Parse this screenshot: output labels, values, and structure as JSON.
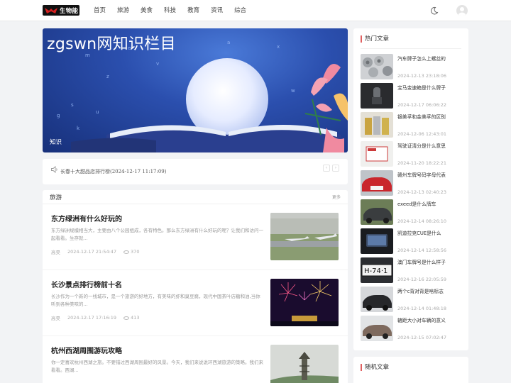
{
  "header": {
    "logo_text": "生物能",
    "nav": [
      "首页",
      "旅游",
      "美食",
      "科技",
      "教育",
      "资讯",
      "综合"
    ],
    "theme_icon": "moon-icon",
    "avatar_icon": "user-avatar-icon"
  },
  "banner": {
    "title": "zgswn网知识栏目",
    "tag": "知识"
  },
  "notice": {
    "text": "长春十大甜品店排行榜(2024-12-17 11:17:09)",
    "icon": "speaker-icon"
  },
  "list": {
    "title": "旅游",
    "more": "更多",
    "articles": [
      {
        "title": "东方绿洲有什么好玩的",
        "excerpt": "东方绿洲规模相当大，主要由八个公园组成，各有特色。那么东方绿洲有什么好玩的呢？让我们和访问一起看看。生存就...",
        "author": "高昊",
        "date": "2024-12-17 21:54:47",
        "views": "370"
      },
      {
        "title": "长沙景点排行榜前十名",
        "excerpt": "长沙作为一个新的一线城市，是一个旅游的好地方，有美味的虾和臭豆腐，现代中国茶叶店糖和油,当你听到各种美味的...",
        "author": "高昊",
        "date": "2024-12-17 17:16:19",
        "views": "413"
      },
      {
        "title": "杭州西湖周围游玩攻略",
        "excerpt": "你一定喜欢杭州西湖之旅。不要错过西湖周围最好的风景。今天，我们来说说环西湖旅游的策略。我们来看看。西湖..."
      }
    ]
  },
  "sidebar": {
    "hot_title": "热门文章",
    "hot": [
      {
        "title": "汽车牌子怎么上螺丝的",
        "date": "2024-12-13 23:18:06"
      },
      {
        "title": "宝马变速箱是什么牌子",
        "date": "2024-12-17 06:06:22"
      },
      {
        "title": "银美孚和金美孚的区别",
        "date": "2024-12-06 12:43:01"
      },
      {
        "title": "驾驶证清分是什么意思",
        "date": "2024-11-20 18:22:21"
      },
      {
        "title": "赣州车牌号码字母代表",
        "date": "2024-12-13 02:40:23"
      },
      {
        "title": "exeed是什么牌车",
        "date": "2024-12-14 08:26:10"
      },
      {
        "title": "凯迪拉克CUE是什么",
        "date": "2024-12-14 12:58:56"
      },
      {
        "title": "澳门车牌号是什么样子",
        "date": "2024-12-16 22:05:59"
      },
      {
        "title": "两个c背对背是啥标志",
        "date": "2024-12-14 01:48:18"
      },
      {
        "title": "辘距大小对车辆的意义",
        "date": "2024-12-15 07:02:47"
      }
    ],
    "random_title": "随机文章"
  }
}
